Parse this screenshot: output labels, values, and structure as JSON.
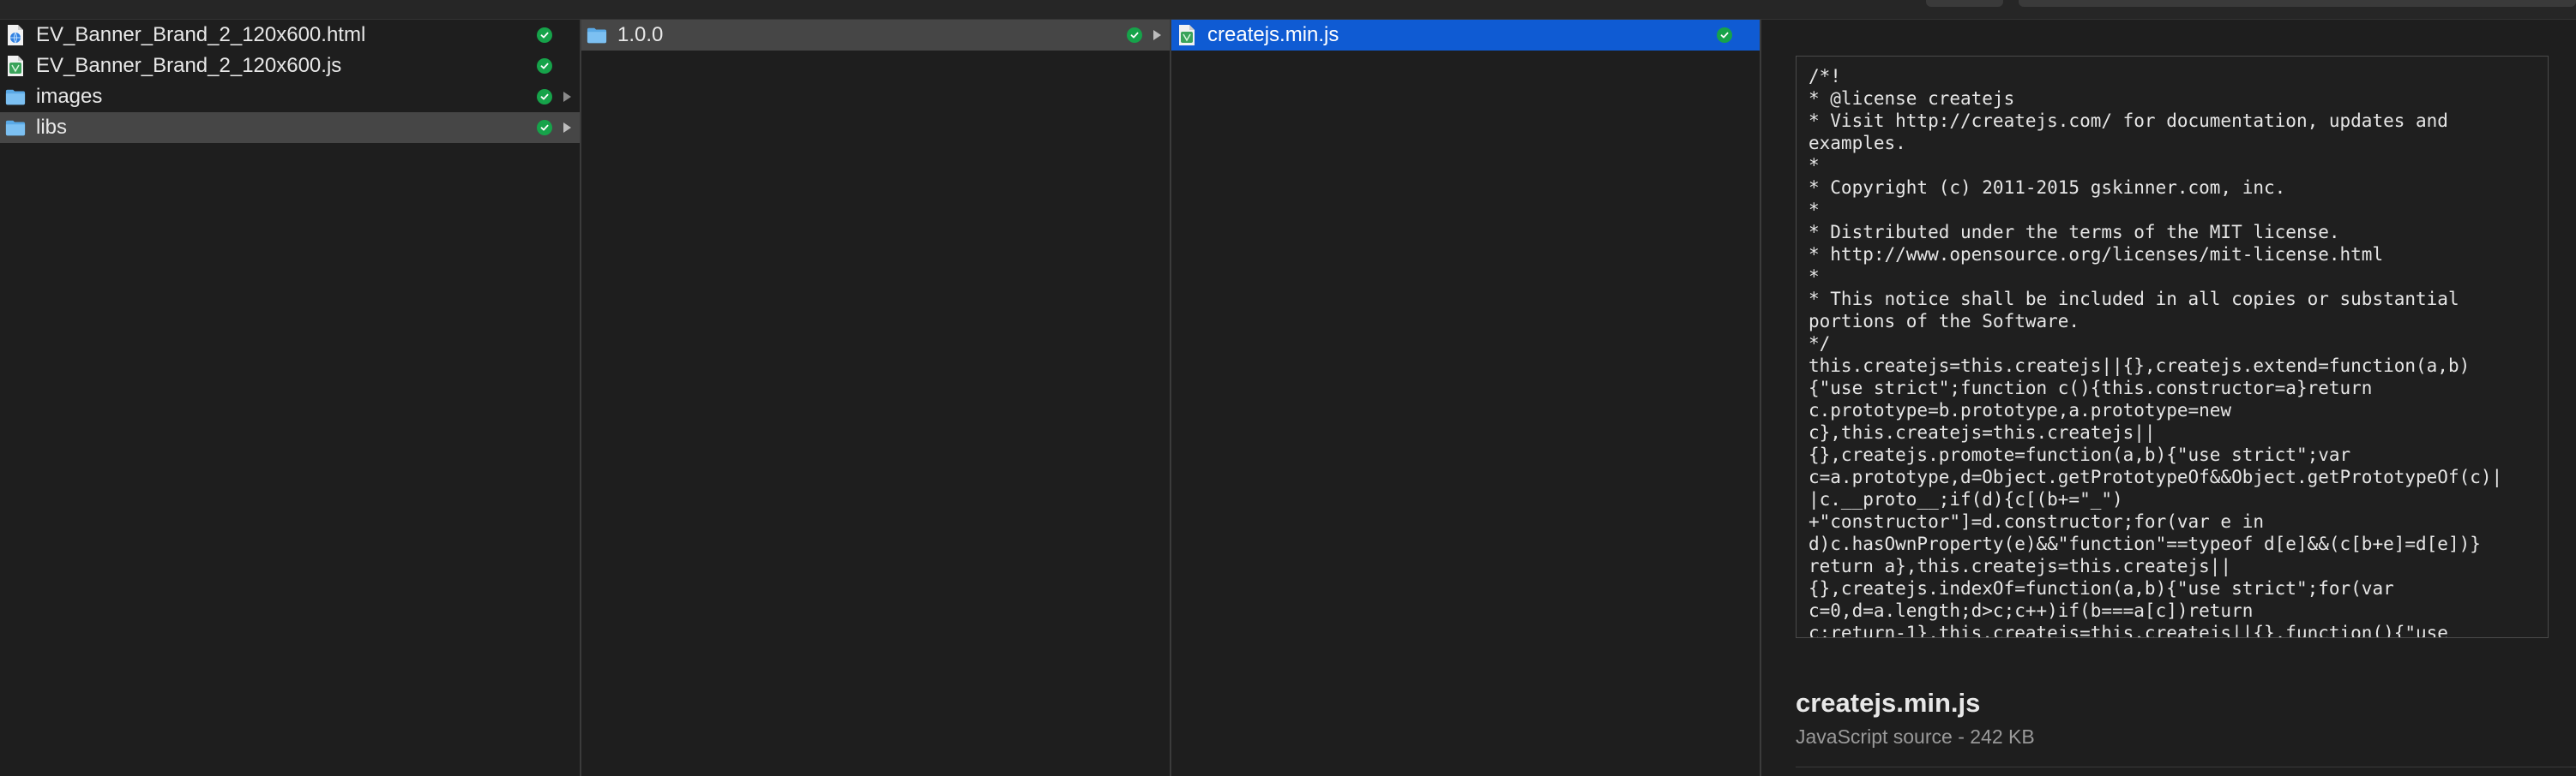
{
  "columns": {
    "first": [
      {
        "name": "EV_Banner_Brand_2_120x600.html",
        "icon": "html-file-icon",
        "synced": true,
        "folder": false,
        "selected": false
      },
      {
        "name": "EV_Banner_Brand_2_120x600.js",
        "icon": "js-file-icon",
        "synced": true,
        "folder": false,
        "selected": false
      },
      {
        "name": "images",
        "icon": "folder-icon",
        "synced": true,
        "folder": true,
        "selected": false
      },
      {
        "name": "libs",
        "icon": "folder-icon",
        "synced": true,
        "folder": true,
        "selected": true
      }
    ],
    "second": [
      {
        "name": "1.0.0",
        "icon": "folder-icon",
        "synced": true,
        "folder": true,
        "selected": true
      }
    ],
    "third": [
      {
        "name": "createjs.min.js",
        "icon": "js-file-icon",
        "synced": true,
        "folder": false,
        "selected": true
      }
    ]
  },
  "preview": {
    "code_lines": [
      "/*!",
      "* @license createjs",
      "* Visit http://createjs.com/ for documentation, updates and",
      "examples.",
      "*",
      "* Copyright (c) 2011-2015 gskinner.com, inc.",
      "*",
      "* Distributed under the terms of the MIT license.",
      "* http://www.opensource.org/licenses/mit-license.html",
      "*",
      "* This notice shall be included in all copies or substantial",
      "portions of the Software.",
      "*/",
      "this.createjs=this.createjs||{},createjs.extend=function(a,b)",
      "{\"use strict\";function c(){this.constructor=a}return",
      "c.prototype=b.prototype,a.prototype=new",
      "c},this.createjs=this.createjs||",
      "{},createjs.promote=function(a,b){\"use strict\";var",
      "c=a.prototype,d=Object.getPrototypeOf&&Object.getPrototypeOf(c)|",
      "|c.__proto__;if(d){c[(b+=\"_\")",
      "+\"constructor\"]=d.constructor;for(var e in",
      "d)c.hasOwnProperty(e)&&\"function\"==typeof d[e]&&(c[b+e]=d[e])}",
      "return a},this.createjs=this.createjs||",
      "{},createjs.indexOf=function(a,b){\"use strict\";for(var",
      "c=0,d=a.length;d>c;c++)if(b===a[c])return",
      "c;return-1},this.createjs=this.createjs||{},function(){\"use"
    ],
    "file_name": "createjs.min.js",
    "file_meta": "JavaScript source - 242 KB"
  },
  "colors": {
    "selection_blue": "#0f5bd3",
    "selection_gray": "#464646",
    "sync_green": "#16a34a",
    "folder_blue": "#5aa9e6"
  }
}
